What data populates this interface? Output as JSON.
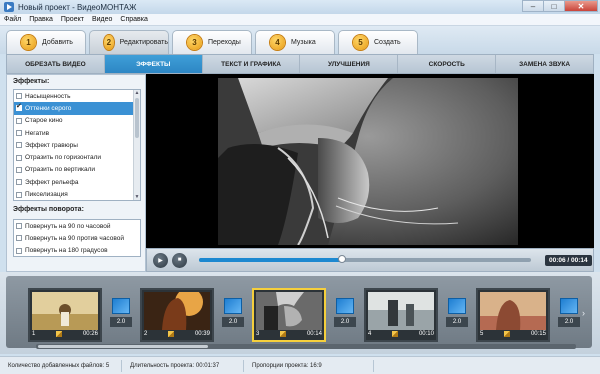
{
  "window": {
    "title": "Новый проект - ВидеоМОНТАЖ",
    "icon": "film-play-icon",
    "buttons": [
      "–",
      "□",
      "✕"
    ]
  },
  "menu": [
    "Файл",
    "Правка",
    "Проект",
    "Видео",
    "Справка"
  ],
  "steps": [
    {
      "num": "1",
      "label": "Добавить"
    },
    {
      "num": "2",
      "label": "Редактировать",
      "active": true
    },
    {
      "num": "3",
      "label": "Переходы"
    },
    {
      "num": "4",
      "label": "Музыка"
    },
    {
      "num": "5",
      "label": "Создать"
    }
  ],
  "subtabs": [
    {
      "label": "ОБРЕЗАТЬ ВИДЕО"
    },
    {
      "label": "ЭФФЕКТЫ",
      "active": true
    },
    {
      "label": "ТЕКСТ И ГРАФИКА"
    },
    {
      "label": "УЛУЧШЕНИЯ"
    },
    {
      "label": "СКОРОСТЬ"
    },
    {
      "label": "ЗАМЕНА ЗВУКА"
    }
  ],
  "effects": {
    "label": "Эффекты:",
    "items": [
      "Насыщенность",
      "Оттенки серого",
      "Старое кино",
      "Негатив",
      "Эффект гравюры",
      "Отразить по горизонтали",
      "Отразить по вертикали",
      "Эффект рельефа",
      "Пикселизация"
    ],
    "selected_index": 1
  },
  "rotation": {
    "label": "Эффекты поворота:",
    "items": [
      "Повернуть на 90 по часовой",
      "Повернуть на 90 против часовой",
      "Повернуть на 180 градусов"
    ]
  },
  "player": {
    "time": "00:06 / 00:14",
    "progress": 0.43,
    "play_icon": "play-icon",
    "stop_icon": "stop-icon"
  },
  "clips": [
    {
      "num": "1",
      "duration": "00:26"
    },
    {
      "num": "2",
      "duration": "00:39"
    },
    {
      "num": "3",
      "duration": "00:14",
      "current": true
    },
    {
      "num": "4",
      "duration": "00:10"
    },
    {
      "num": "5",
      "duration": "00:15"
    }
  ],
  "transitions": [
    "2.0",
    "2.0",
    "2.0",
    "2.0",
    "2.0"
  ],
  "status": {
    "files": "Количество добавленных файлов: 5",
    "duration": "Длительность проекта:  00:01:37",
    "ratio": "Пропорции проекта:  16:9"
  },
  "colors": {
    "accent": "#2d86c4",
    "selection": "#3b91d4",
    "current_clip": "#f5cf3c"
  }
}
